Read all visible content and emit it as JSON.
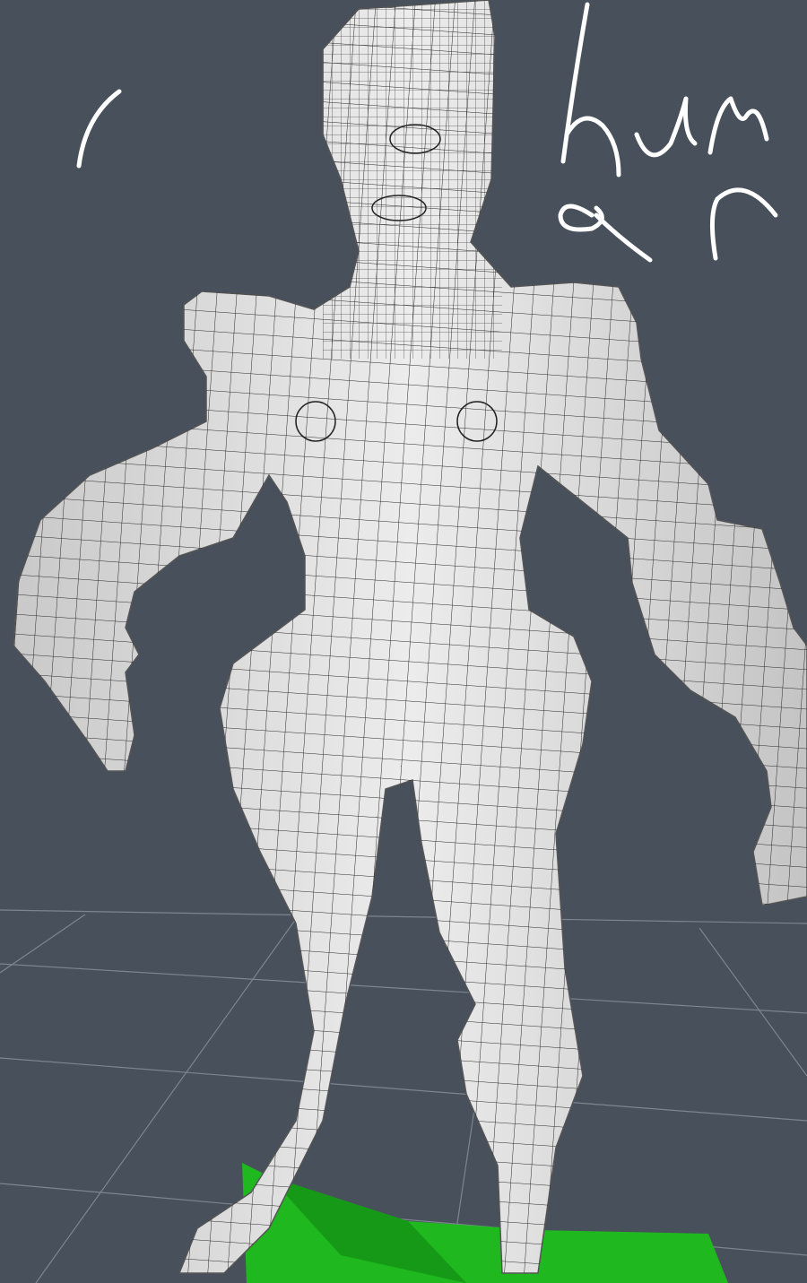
{
  "viewport": {
    "background_color": "#47505b",
    "grid_color": "#7c8590",
    "mesh_color": "#d9d9d9",
    "wire_color": "#2a2a2a",
    "base_color": "#1fb81f"
  },
  "annotation": {
    "handwritten_text": "human",
    "stroke_color": "#ffffff"
  }
}
